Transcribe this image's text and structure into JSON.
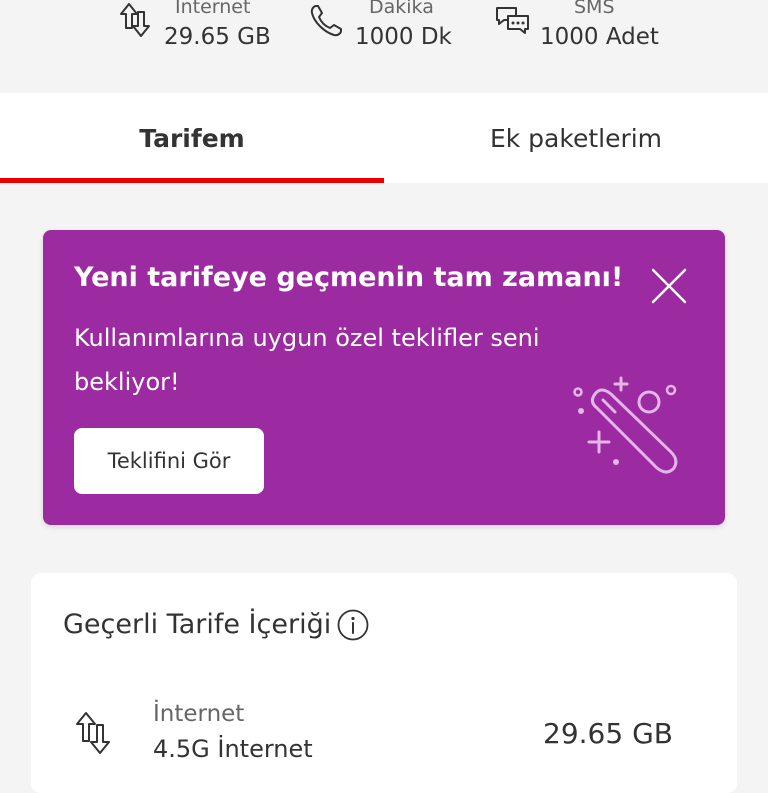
{
  "summary": {
    "internet": {
      "label": "Internet",
      "value": "29.65 GB",
      "icon": "data-transfer-icon"
    },
    "minutes": {
      "label": "Dakika",
      "value": "1000 Dk",
      "icon": "phone-icon"
    },
    "sms": {
      "label": "SMS",
      "value": "1000 Adet",
      "icon": "chat-bubbles-icon"
    }
  },
  "tabs": [
    {
      "label": "Tarifem",
      "active": true
    },
    {
      "label": "Ek paketlerim",
      "active": false
    }
  ],
  "promo": {
    "title": "Yeni tarifeye geçmenin tam zamanı!",
    "text": "Kullanımlarına uygun özel teklifler seni bekliyor!",
    "button_label": "Teklifini Gör",
    "close_icon": "close-icon",
    "illustration": "magic-wand-icon",
    "background_color": "#9c2aa0"
  },
  "tariff_card": {
    "title": "Geçerli Tarife İçeriği",
    "info_icon": "info-icon",
    "rows": [
      {
        "label": "İnternet",
        "sublabel": "4.5G İnternet",
        "value": "29.65 GB",
        "icon": "data-transfer-icon"
      }
    ]
  },
  "colors": {
    "accent": "#e60000",
    "promo": "#9c2aa0"
  }
}
